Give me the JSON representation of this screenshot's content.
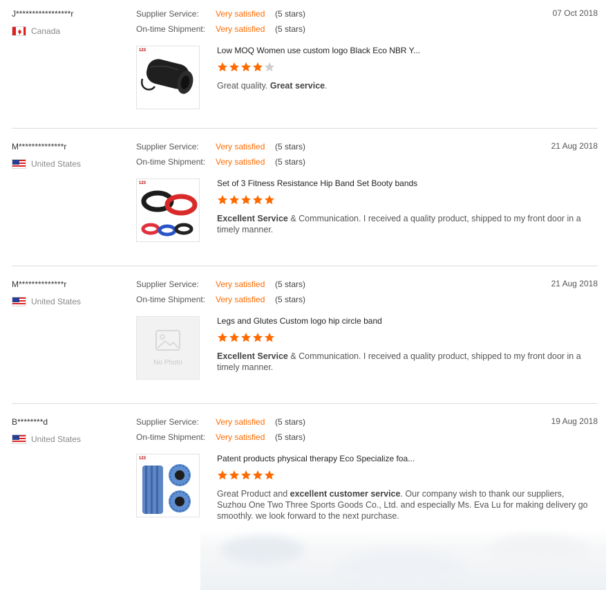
{
  "reviews": [
    {
      "buyer": "J*****************r",
      "country": "Canada",
      "flag": "canada-flag",
      "date": "07 Oct 2018",
      "supplier_label": "Supplier Service:",
      "supplier_value": "Very satisfied",
      "supplier_stars": "(5 stars)",
      "shipment_label": "On-time Shipment:",
      "shipment_value": "Very satisfied",
      "shipment_stars": "(5 stars)",
      "product_title": "Low MOQ Women use custom logo Black Eco NBR Y...",
      "product_image": "yoga-mat-image",
      "product_rating": 4,
      "comment_parts": [
        "Great quality. ",
        "Great service",
        "."
      ],
      "comment_bold": [
        false,
        true,
        false
      ]
    },
    {
      "buyer": "M**************r",
      "country": "United States",
      "flag": "usa-flag",
      "date": "21 Aug 2018",
      "supplier_label": "Supplier Service:",
      "supplier_value": "Very satisfied",
      "supplier_stars": "(5 stars)",
      "shipment_label": "On-time Shipment:",
      "shipment_value": "Very satisfied",
      "shipment_stars": "(5 stars)",
      "product_title": "Set of 3 Fitness Resistance Hip Band Set Booty bands",
      "product_image": "hip-bands-image",
      "product_rating": 5,
      "comment_parts": [
        "Excellent Service",
        " & Communication. I received a quality product, shipped to my front door in a timely manner."
      ],
      "comment_bold": [
        true,
        false
      ]
    },
    {
      "buyer": "M**************r",
      "country": "United States",
      "flag": "usa-flag",
      "date": "21 Aug 2018",
      "supplier_label": "Supplier Service:",
      "supplier_value": "Very satisfied",
      "supplier_stars": "(5 stars)",
      "shipment_label": "On-time Shipment:",
      "shipment_value": "Very satisfied",
      "shipment_stars": "(5 stars)",
      "product_title": "Legs and Glutes Custom logo hip circle band",
      "product_image": "no-photo-placeholder",
      "no_photo_text": "No Photo",
      "product_rating": 5,
      "comment_parts": [
        "Excellent Service",
        " & Communication. I received a quality product, shipped to my front door in a timely manner."
      ],
      "comment_bold": [
        true,
        false
      ]
    },
    {
      "buyer": "B********d",
      "country": "United States",
      "flag": "usa-flag",
      "date": "19 Aug 2018",
      "supplier_label": "Supplier Service:",
      "supplier_value": "Very satisfied",
      "supplier_stars": "(5 stars)",
      "shipment_label": "On-time Shipment:",
      "shipment_value": "Very satisfied",
      "shipment_stars": "(5 stars)",
      "product_title": "Patent products physical therapy Eco Specialize foa...",
      "product_image": "foam-roller-image",
      "product_rating": 5,
      "comment_parts": [
        "Great Product and ",
        "excellent customer service",
        ". Our company wish to thank our suppliers, Suzhou One Two Three Sports Goods Co., Ltd. and especially Ms. Eva Lu for making delivery go smoothly. we look forward to the next purchase."
      ],
      "comment_bold": [
        false,
        true,
        false
      ]
    }
  ],
  "thumb_logo_text": "123",
  "colors": {
    "accent": "#ff6a00",
    "star_filled": "#ff6a00",
    "star_empty": "#cfcfcf",
    "separator": "#dcdcdc"
  }
}
